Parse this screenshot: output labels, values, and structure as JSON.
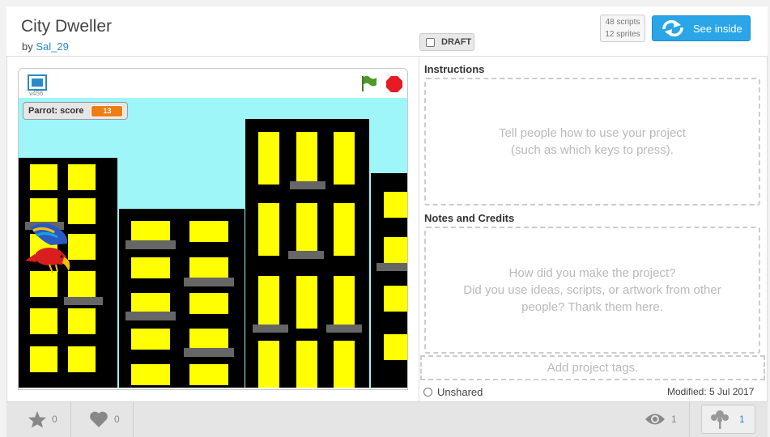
{
  "project": {
    "title": "City Dweller",
    "by_prefix": "by",
    "author": "Sal_29",
    "draft_label": "DRAFT",
    "scripts_count": "48 scripts",
    "sprites_count": "12 sprites",
    "see_inside_label": "See inside"
  },
  "player": {
    "version": "v456",
    "monitor_label": "Parrot: score",
    "monitor_value": "13"
  },
  "instructions": {
    "label": "Instructions",
    "placeholder_line1": "Tell people how to use your project",
    "placeholder_line2": "(such as which keys to press)."
  },
  "notes": {
    "label": "Notes and Credits",
    "placeholder_line1": "How did you make the project?",
    "placeholder_line2": "Did you use ideas, scripts, or artwork from other",
    "placeholder_line3": "people? Thank them here."
  },
  "tags_placeholder": "Add project tags.",
  "status": {
    "shared": "Unshared",
    "modified": "Modified: 5 Jul 2017"
  },
  "footer": {
    "favorites": "0",
    "loves": "0",
    "views": "1",
    "remixes": "1"
  },
  "colors": {
    "accent": "#2aa6e8",
    "sky": "#9ef6f9",
    "building": "#000000",
    "window": "#ffff00",
    "ledge": "#666666",
    "monitor_value_bg": "#ee7d16"
  },
  "icons": [
    "fullscreen-icon",
    "green-flag-icon",
    "stop-icon",
    "see-inside-icon",
    "star-icon",
    "heart-icon",
    "eye-icon",
    "remix-tree-icon",
    "unshared-icon"
  ]
}
